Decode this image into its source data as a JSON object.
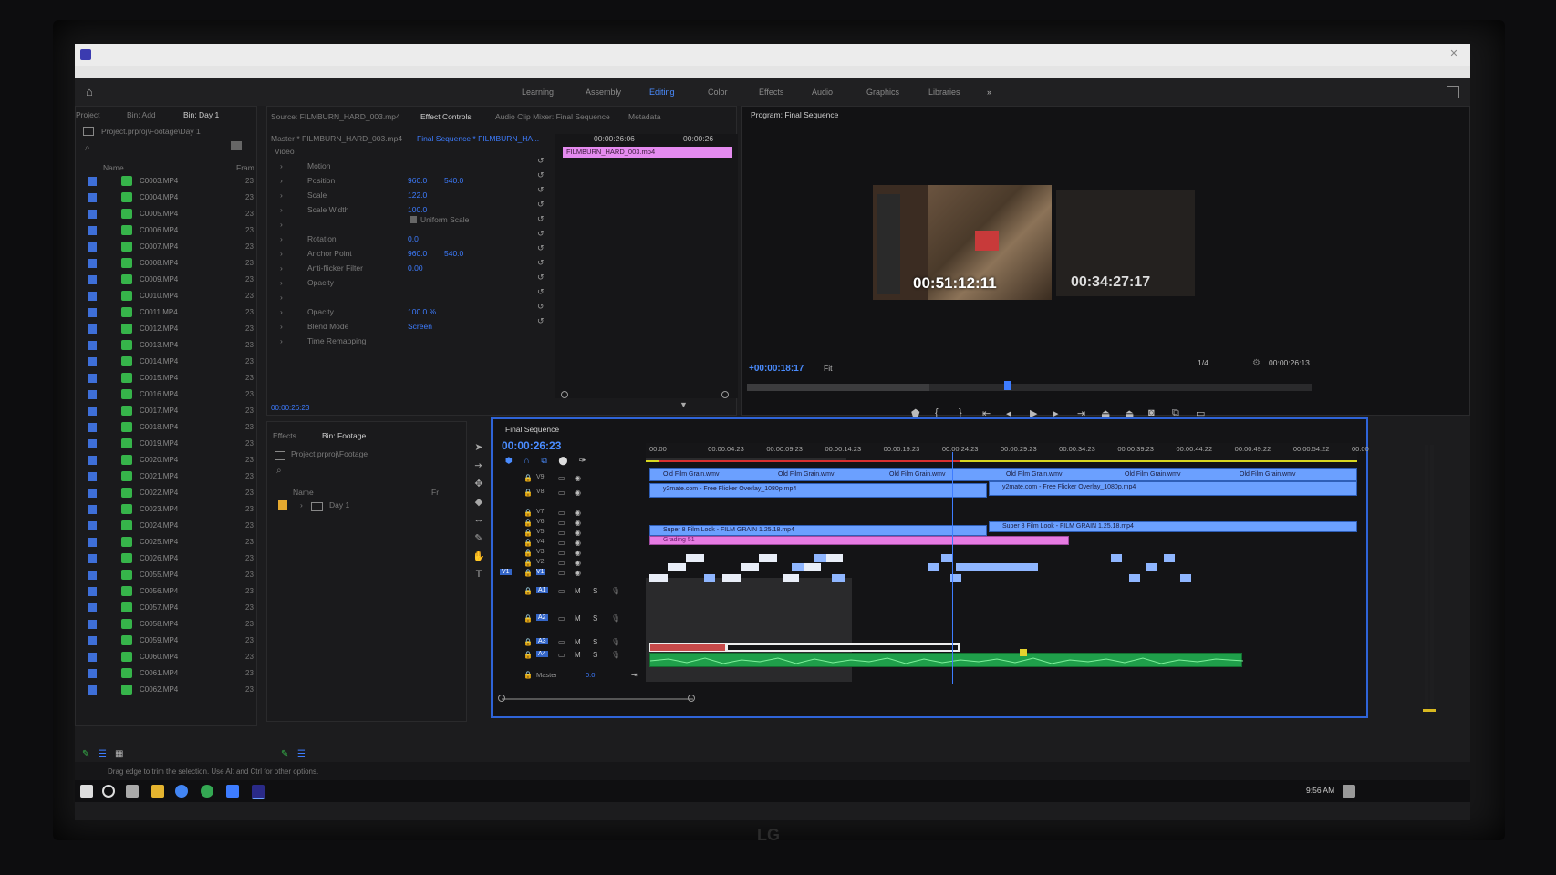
{
  "workspaces": [
    "Learning",
    "Assembly",
    "Editing",
    "Color",
    "Effects",
    "Audio",
    "Graphics",
    "Libraries"
  ],
  "workspace_overflow": "»",
  "project_panel": {
    "tabs": [
      "Project",
      "Bin: Add",
      "Bin: Day 1"
    ],
    "path": "Project.prproj\\Footage\\Day 1",
    "col_name": "Name",
    "col_frame": "Fram",
    "items": [
      {
        "name": "C0003.MP4",
        "frame": "23"
      },
      {
        "name": "C0004.MP4",
        "frame": "23"
      },
      {
        "name": "C0005.MP4",
        "frame": "23"
      },
      {
        "name": "C0006.MP4",
        "frame": "23"
      },
      {
        "name": "C0007.MP4",
        "frame": "23"
      },
      {
        "name": "C0008.MP4",
        "frame": "23"
      },
      {
        "name": "C0009.MP4",
        "frame": "23"
      },
      {
        "name": "C0010.MP4",
        "frame": "23"
      },
      {
        "name": "C0011.MP4",
        "frame": "23"
      },
      {
        "name": "C0012.MP4",
        "frame": "23"
      },
      {
        "name": "C0013.MP4",
        "frame": "23"
      },
      {
        "name": "C0014.MP4",
        "frame": "23"
      },
      {
        "name": "C0015.MP4",
        "frame": "23"
      },
      {
        "name": "C0016.MP4",
        "frame": "23"
      },
      {
        "name": "C0017.MP4",
        "frame": "23"
      },
      {
        "name": "C0018.MP4",
        "frame": "23"
      },
      {
        "name": "C0019.MP4",
        "frame": "23"
      },
      {
        "name": "C0020.MP4",
        "frame": "23"
      },
      {
        "name": "C0021.MP4",
        "frame": "23"
      },
      {
        "name": "C0022.MP4",
        "frame": "23"
      },
      {
        "name": "C0023.MP4",
        "frame": "23"
      },
      {
        "name": "C0024.MP4",
        "frame": "23"
      },
      {
        "name": "C0025.MP4",
        "frame": "23"
      },
      {
        "name": "C0026.MP4",
        "frame": "23"
      },
      {
        "name": "C0055.MP4",
        "frame": "23"
      },
      {
        "name": "C0056.MP4",
        "frame": "23"
      },
      {
        "name": "C0057.MP4",
        "frame": "23"
      },
      {
        "name": "C0058.MP4",
        "frame": "23"
      },
      {
        "name": "C0059.MP4",
        "frame": "23"
      },
      {
        "name": "C0060.MP4",
        "frame": "23"
      },
      {
        "name": "C0061.MP4",
        "frame": "23"
      },
      {
        "name": "C0062.MP4",
        "frame": "23"
      }
    ]
  },
  "effect_controls": {
    "tabs": [
      "Source: FILMBURN_HARD_003.mp4",
      "Effect Controls",
      "Audio Clip Mixer: Final Sequence",
      "Metadata"
    ],
    "master": "Master * FILMBURN_HARD_003.mp4",
    "sequence": "Final Sequence * FILMBURN_HA...",
    "section": "Video",
    "timecode_start": "00:00:26:06",
    "timecode_end": "00:00:26",
    "clip_name": "FILMBURN_HARD_003.mp4",
    "rows": [
      {
        "label": "Motion",
        "v1": "",
        "v2": ""
      },
      {
        "label": "Position",
        "v1": "960.0",
        "v2": "540.0"
      },
      {
        "label": "Scale",
        "v1": "122.0",
        "v2": ""
      },
      {
        "label": "Scale Width",
        "v1": "100.0",
        "v2": ""
      },
      {
        "label": "",
        "v1": "",
        "v2": ""
      },
      {
        "label": "Rotation",
        "v1": "0.0",
        "v2": ""
      },
      {
        "label": "Anchor Point",
        "v1": "960.0",
        "v2": "540.0"
      },
      {
        "label": "Anti-flicker Filter",
        "v1": "0.00",
        "v2": ""
      },
      {
        "label": "Opacity",
        "v1": "",
        "v2": ""
      },
      {
        "label": "",
        "v1": "",
        "v2": ""
      },
      {
        "label": "Opacity",
        "v1": "100.0 %",
        "v2": ""
      },
      {
        "label": "Blend Mode",
        "v1": "Screen",
        "v2": ""
      },
      {
        "label": "Time Remapping",
        "v1": "",
        "v2": ""
      }
    ],
    "uniform_scale": "Uniform Scale",
    "current_time": "00:00:26:23"
  },
  "bin_footage": {
    "tabs": [
      "Effects",
      "Bin: Footage"
    ],
    "path": "Project.prproj\\Footage",
    "col_name": "Name",
    "col_frame": "Fr",
    "folder": "Day 1"
  },
  "program_monitor": {
    "title": "Program: Final Sequence",
    "overlay_tc_1": "00:51:12:11",
    "overlay_tc_2": "00:34:27:17",
    "playhead_tc": "+00:00:18:17",
    "fit": "Fit",
    "resolution": "1/4",
    "duration": "00:00:26:13"
  },
  "timeline": {
    "title": "Final Sequence",
    "timecode": "00:00:26:23",
    "ruler": [
      "00:00",
      "00:00:04:23",
      "00:00:09:23",
      "00:00:14:23",
      "00:00:19:23",
      "00:00:24:23",
      "00:00:29:23",
      "00:00:34:23",
      "00:00:39:23",
      "00:00:44:22",
      "00:00:49:22",
      "00:00:54:22",
      "00:00"
    ],
    "video_tracks": [
      "V9",
      "V8",
      "V7",
      "V6",
      "V5",
      "V4",
      "V3",
      "V2",
      "V1"
    ],
    "audio_tracks": [
      "A1",
      "A2",
      "A3",
      "A4"
    ],
    "master_label": "Master",
    "master_value": "0.0",
    "clips": {
      "grain1": "Old Film Grain.wmv",
      "grain2": "Old Film Grain.wmv",
      "grain3": "Old Film Grain.wmv",
      "grain4": "Old Film Grain.wmv",
      "grain5": "Old Film Grain.wmv",
      "grain6": "Old Film Grain.wmv",
      "overlay1": "y2mate.com - Free Flicker Overlay_1080p.mp4",
      "overlay2": "y2mate.com - Free Flicker Overlay_1080p.mp4",
      "superb1": "Super 8 Film Look - FILM GRAIN 1.25.18.mp4",
      "superb2": "Super 8 Film Look - FILM GRAIN 1.25.18.mp4",
      "grading": "Grading 51"
    },
    "track_buttons": {
      "mute": "M",
      "solo": "S"
    }
  },
  "status": {
    "hint": "Drag edge to trim the selection. Use Alt and Ctrl for other options.",
    "clock": "9:56 AM"
  },
  "monitor_brand": "LG",
  "colors": {
    "accent": "#3d7cff",
    "video_clip": "#6ba0ff",
    "adjustment_clip": "#e67be2",
    "audio_clip": "#1f9f4a",
    "playhead": "#3d7cff"
  }
}
